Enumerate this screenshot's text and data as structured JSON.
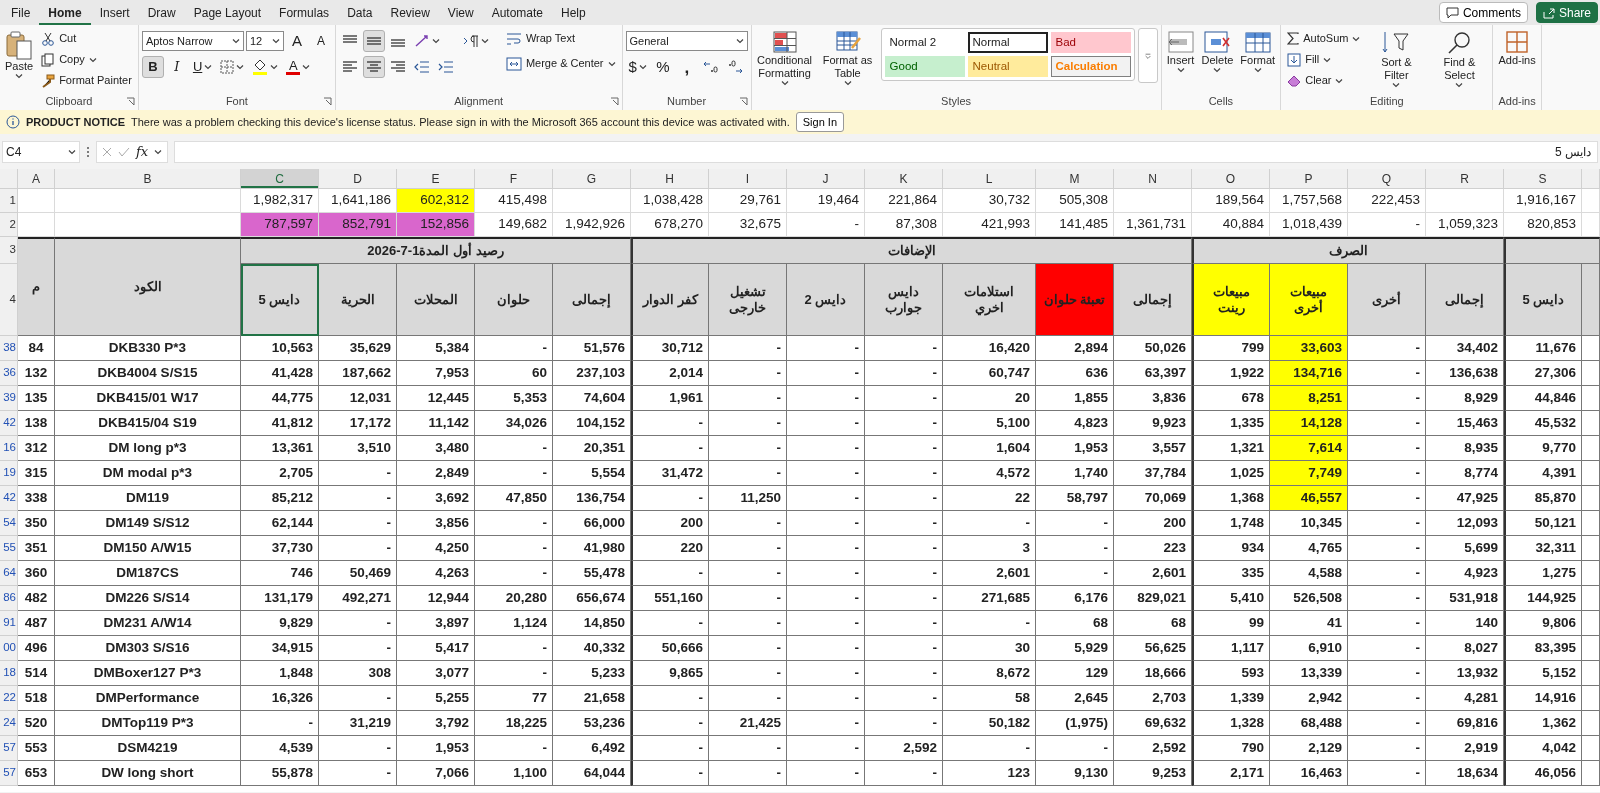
{
  "menu_tabs": [
    {
      "label": "File",
      "selected": false
    },
    {
      "label": "Home",
      "selected": true
    },
    {
      "label": "Insert",
      "selected": false
    },
    {
      "label": "Draw",
      "selected": false
    },
    {
      "label": "Page Layout",
      "selected": false
    },
    {
      "label": "Formulas",
      "selected": false
    },
    {
      "label": "Data",
      "selected": false
    },
    {
      "label": "Review",
      "selected": false
    },
    {
      "label": "View",
      "selected": false
    },
    {
      "label": "Automate",
      "selected": false
    },
    {
      "label": "Help",
      "selected": false
    }
  ],
  "top_buttons": {
    "comments": "Comments",
    "share": "Share"
  },
  "ribbon": {
    "clipboard": {
      "label": "Clipboard",
      "paste": "Paste",
      "cut": "Cut",
      "copy": "Copy",
      "format_painter": "Format Painter"
    },
    "font": {
      "label": "Font",
      "name": "Aptos Narrow",
      "size": "12",
      "grow": "A",
      "shrink": "A",
      "bold": {
        "label": "B",
        "selected": true
      },
      "italic": {
        "label": "I",
        "selected": false
      },
      "underline": {
        "label": "U",
        "selected": false
      },
      "font_color": "A"
    },
    "alignment": {
      "label": "Alignment",
      "vertical": [
        {
          "selected": false
        },
        {
          "selected": true
        },
        {
          "selected": false
        }
      ],
      "horizontal": [
        {
          "selected": false
        },
        {
          "selected": true
        },
        {
          "selected": false
        }
      ],
      "wrap_text": "Wrap Text",
      "merge_center": "Merge & Center"
    },
    "number": {
      "label": "Number",
      "format": "General",
      "currency": "$",
      "percent": "%",
      "comma": ","
    },
    "styles": {
      "label": "Styles",
      "conditional_formatting": "Conditional Formatting",
      "format_as_table": "Format as Table",
      "gallery": [
        {
          "label": "Normal 2",
          "color": "#ffffff",
          "selected": false
        },
        {
          "label": "Normal",
          "color": "#ffffff",
          "selected": true
        },
        {
          "label": "Bad",
          "color": "#ffc7ce",
          "selected": false
        },
        {
          "label": "Good",
          "color": "#c6efce",
          "selected": false
        },
        {
          "label": "Neutral",
          "color": "#ffeb9c",
          "selected": false
        },
        {
          "label": "Calculation",
          "color": "#f2f2f2",
          "selected": false
        }
      ]
    },
    "cells": {
      "label": "Cells",
      "insert": "Insert",
      "delete": "Delete",
      "format": "Format"
    },
    "editing": {
      "label": "Editing",
      "autosum": "AutoSum",
      "fill": "Fill",
      "clear": "Clear",
      "sort_filter": "Sort & Filter",
      "find_select": "Find & Select"
    },
    "addins": {
      "label": "Add-ins",
      "addins": "Add-ins"
    }
  },
  "notice": {
    "title": "PRODUCT NOTICE",
    "message": "There was a problem checking this device's license status. Please sign in with the Microsoft 365 account this device was activated with.",
    "button": "Sign In"
  },
  "formula_bar": {
    "name_box": "C4",
    "fx": "fx",
    "value": "دايس 5"
  },
  "sheet": {
    "columns": [
      {
        "label": "A",
        "selected": false
      },
      {
        "label": "B",
        "selected": false
      },
      {
        "label": "C",
        "selected": true
      },
      {
        "label": "D",
        "selected": false
      },
      {
        "label": "E",
        "selected": false
      },
      {
        "label": "F",
        "selected": false
      },
      {
        "label": "G",
        "selected": false
      },
      {
        "label": "H",
        "selected": false
      },
      {
        "label": "I",
        "selected": false
      },
      {
        "label": "J",
        "selected": false
      },
      {
        "label": "K",
        "selected": false
      },
      {
        "label": "L",
        "selected": false
      },
      {
        "label": "M",
        "selected": false
      },
      {
        "label": "N",
        "selected": false
      },
      {
        "label": "O",
        "selected": false
      },
      {
        "label": "P",
        "selected": false
      },
      {
        "label": "Q",
        "selected": false
      },
      {
        "label": "R",
        "selected": false
      },
      {
        "label": "S",
        "selected": false
      }
    ],
    "total_rows": [
      {
        "row_number": "1",
        "cells": [
          null,
          null,
          {
            "value": "1,982,317"
          },
          {
            "value": "1,641,186"
          },
          {
            "value": "602,312",
            "color": "#ffff00"
          },
          {
            "value": "415,498"
          },
          null,
          {
            "value": "1,038,428"
          },
          {
            "value": "29,761"
          },
          {
            "value": "19,464"
          },
          {
            "value": "221,864"
          },
          {
            "value": "30,732"
          },
          {
            "value": "505,308"
          },
          null,
          {
            "value": "189,564"
          },
          {
            "value": "1,757,568"
          },
          {
            "value": "222,453"
          },
          null,
          {
            "value": "1,916,167"
          }
        ]
      },
      {
        "row_number": "2",
        "cells": [
          null,
          null,
          {
            "value": "787,597",
            "color": "#d966cc"
          },
          {
            "value": "852,791",
            "color": "#d966cc"
          },
          {
            "value": "152,856",
            "color": "#d966cc"
          },
          {
            "value": "149,682"
          },
          {
            "value": "1,942,926"
          },
          {
            "value": "678,270"
          },
          {
            "value": "32,675"
          },
          {
            "value": "-"
          },
          {
            "value": "87,308"
          },
          {
            "value": "421,993"
          },
          {
            "value": "141,485"
          },
          {
            "value": "1,361,731"
          },
          {
            "value": "40,884"
          },
          {
            "value": "1,018,439"
          },
          {
            "value": "-"
          },
          {
            "value": "1,059,323"
          },
          {
            "value": "820,853"
          }
        ]
      }
    ],
    "group_row": {
      "row_number": "3",
      "groups": [
        "الصرف",
        "الإضافات",
        "2026-7-1رصيد أول المدة"
      ]
    },
    "header_row": {
      "row_number": "4",
      "cells": [
        {
          "label": "دايس 5"
        },
        {
          "label": "إجمالى"
        },
        {
          "label": "أخرى"
        },
        {
          "label": "مبيعات أخرى",
          "color": "#ffff00"
        },
        {
          "label": "مبيعات رينت",
          "color": "#ffff00"
        },
        {
          "label": "إجمالى"
        },
        {
          "label": "تعبئة حلوان",
          "color": "#ff0000"
        },
        {
          "label": "استلامات اخري"
        },
        {
          "label": "دايس جوارب"
        },
        {
          "label": "دايس 2"
        },
        {
          "label": "تشغيل خارجى"
        },
        {
          "label": "كفر الدوار"
        },
        {
          "label": "إجمالى"
        },
        {
          "label": "حلوان"
        },
        {
          "label": "المحلات"
        },
        {
          "label": "الحرية"
        },
        {
          "label": "دايس 5"
        },
        {
          "label": "الكود"
        },
        {
          "label": "م"
        }
      ]
    },
    "rows": [
      {
        "row_number": "38",
        "highlight": true,
        "cells": [
          "84",
          "DKB330 P*3",
          "10,563",
          "35,629",
          "5,384",
          "-",
          "51,576",
          "30,712",
          "-",
          "-",
          "-",
          "16,420",
          "2,894",
          "50,026",
          "799",
          "33,603",
          "-",
          "34,402",
          "11,676"
        ]
      },
      {
        "row_number": "36",
        "highlight": true,
        "cells": [
          "132",
          "DKB4004 S/S15",
          "41,428",
          "187,662",
          "7,953",
          "60",
          "237,103",
          "2,014",
          "-",
          "-",
          "-",
          "60,747",
          "636",
          "63,397",
          "1,922",
          "134,716",
          "-",
          "136,638",
          "27,306"
        ]
      },
      {
        "row_number": "39",
        "highlight": true,
        "cells": [
          "135",
          "DKB415/01 W17",
          "44,775",
          "12,031",
          "12,445",
          "5,353",
          "74,604",
          "1,961",
          "-",
          "-",
          "-",
          "20",
          "1,855",
          "3,836",
          "678",
          "8,251",
          "-",
          "8,929",
          "44,846"
        ]
      },
      {
        "row_number": "42",
        "highlight": true,
        "cells": [
          "138",
          "DKB415/04 S19",
          "41,812",
          "17,172",
          "11,142",
          "34,026",
          "104,152",
          "-",
          "-",
          "-",
          "-",
          "5,100",
          "4,823",
          "9,923",
          "1,335",
          "14,128",
          "-",
          "15,463",
          "45,532"
        ]
      },
      {
        "row_number": "16",
        "highlight": true,
        "cells": [
          "312",
          "DM long p*3",
          "13,361",
          "3,510",
          "3,480",
          "-",
          "20,351",
          "-",
          "-",
          "-",
          "-",
          "1,604",
          "1,953",
          "3,557",
          "1,321",
          "7,614",
          "-",
          "8,935",
          "9,770"
        ]
      },
      {
        "row_number": "19",
        "highlight": true,
        "cells": [
          "315",
          "DM modal p*3",
          "2,705",
          "-",
          "2,849",
          "-",
          "5,554",
          "31,472",
          "-",
          "-",
          "-",
          "4,572",
          "1,740",
          "37,784",
          "1,025",
          "7,749",
          "-",
          "8,774",
          "4,391"
        ]
      },
      {
        "row_number": "42",
        "highlight": true,
        "cells": [
          "338",
          "DM119",
          "85,212",
          "-",
          "3,692",
          "47,850",
          "136,754",
          "-",
          "11,250",
          "-",
          "-",
          "22",
          "58,797",
          "70,069",
          "1,368",
          "46,557",
          "-",
          "47,925",
          "85,870"
        ]
      },
      {
        "row_number": "54",
        "highlight": false,
        "cells": [
          "350",
          "DM149 S/S12",
          "62,144",
          "-",
          "3,856",
          "-",
          "66,000",
          "200",
          "-",
          "-",
          "-",
          "-",
          "-",
          "200",
          "1,748",
          "10,345",
          "-",
          "12,093",
          "50,121"
        ]
      },
      {
        "row_number": "55",
        "highlight": false,
        "cells": [
          "351",
          "DM150 A/W15",
          "37,730",
          "-",
          "4,250",
          "-",
          "41,980",
          "220",
          "-",
          "-",
          "-",
          "3",
          "-",
          "223",
          "934",
          "4,765",
          "-",
          "5,699",
          "32,311"
        ]
      },
      {
        "row_number": "64",
        "highlight": false,
        "cells": [
          "360",
          "DM187CS",
          "746",
          "50,469",
          "4,263",
          "-",
          "55,478",
          "-",
          "-",
          "-",
          "-",
          "2,601",
          "-",
          "2,601",
          "335",
          "4,588",
          "-",
          "4,923",
          "1,275"
        ]
      },
      {
        "row_number": "86",
        "highlight": false,
        "cells": [
          "482",
          "DM226 S/S14",
          "131,179",
          "492,271",
          "12,944",
          "20,280",
          "656,674",
          "551,160",
          "-",
          "-",
          "-",
          "271,685",
          "6,176",
          "829,021",
          "5,410",
          "526,508",
          "-",
          "531,918",
          "144,925"
        ]
      },
      {
        "row_number": "91",
        "highlight": false,
        "cells": [
          "487",
          "DM231 A/W14",
          "9,829",
          "-",
          "3,897",
          "1,124",
          "14,850",
          "-",
          "-",
          "-",
          "-",
          "-",
          "68",
          "68",
          "99",
          "41",
          "-",
          "140",
          "9,806"
        ]
      },
      {
        "row_number": "00",
        "highlight": false,
        "cells": [
          "496",
          "DM303 S/S16",
          "34,915",
          "-",
          "5,417",
          "-",
          "40,332",
          "50,666",
          "-",
          "-",
          "-",
          "30",
          "5,929",
          "56,625",
          "1,117",
          "6,910",
          "-",
          "8,027",
          "83,395"
        ]
      },
      {
        "row_number": "18",
        "highlight": false,
        "cells": [
          "514",
          "DMBoxer127 P*3",
          "1,848",
          "308",
          "3,077",
          "-",
          "5,233",
          "9,865",
          "-",
          "-",
          "-",
          "8,672",
          "129",
          "18,666",
          "593",
          "13,339",
          "-",
          "13,932",
          "5,152"
        ]
      },
      {
        "row_number": "22",
        "highlight": false,
        "cells": [
          "518",
          "DMPerformance",
          "16,326",
          "-",
          "5,255",
          "77",
          "21,658",
          "-",
          "-",
          "-",
          "-",
          "58",
          "2,645",
          "2,703",
          "1,339",
          "2,942",
          "-",
          "4,281",
          "14,916"
        ]
      },
      {
        "row_number": "24",
        "highlight": false,
        "cells": [
          "520",
          "DMTop119 P*3",
          "-",
          "31,219",
          "3,792",
          "18,225",
          "53,236",
          "-",
          "21,425",
          "-",
          "-",
          "50,182",
          "(1,975)",
          "69,632",
          "1,328",
          "68,488",
          "-",
          "69,816",
          "1,362"
        ]
      },
      {
        "row_number": "57",
        "highlight": false,
        "cells": [
          "553",
          "DSM4219",
          "4,539",
          "-",
          "1,953",
          "-",
          "6,492",
          "-",
          "-",
          "-",
          "2,592",
          "-",
          "-",
          "2,592",
          "790",
          "2,129",
          "-",
          "2,919",
          "4,042"
        ]
      },
      {
        "row_number": "57",
        "highlight": false,
        "cells": [
          "653",
          "DW long short",
          "55,878",
          "-",
          "7,066",
          "1,100",
          "64,044",
          "-",
          "-",
          "-",
          "-",
          "123",
          "9,130",
          "9,253",
          "2,171",
          "16,463",
          "-",
          "18,634",
          "46,056"
        ]
      }
    ]
  }
}
